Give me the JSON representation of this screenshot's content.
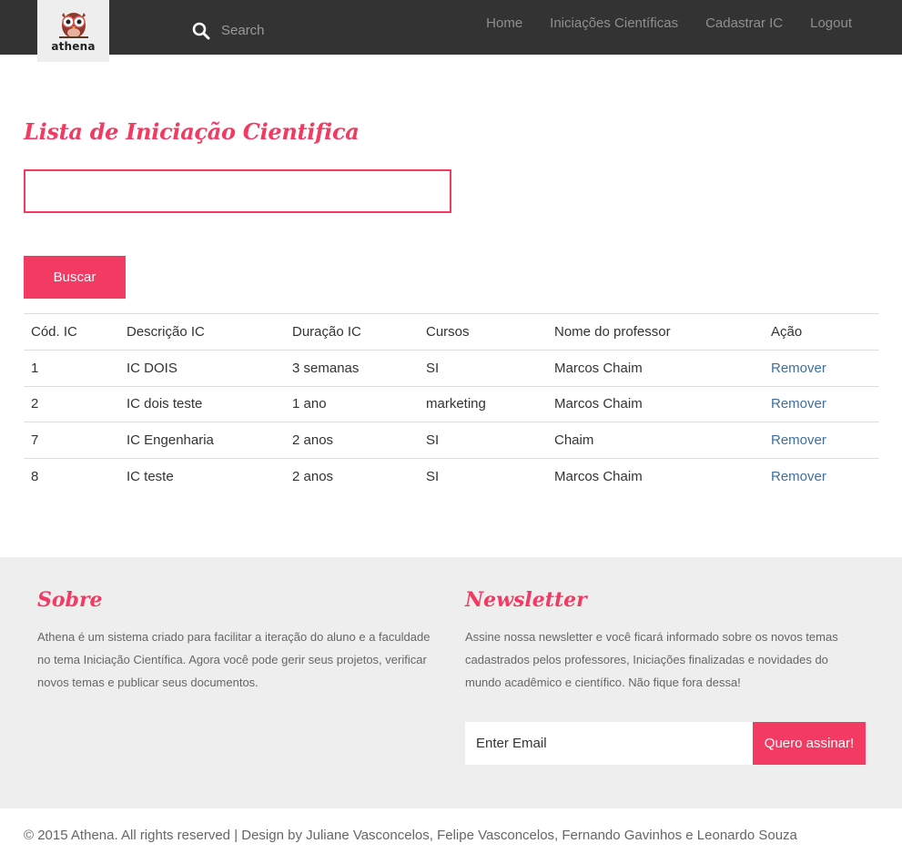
{
  "header": {
    "logo_text": "athena",
    "search_placeholder": "Search",
    "nav": [
      "Home",
      "Iniciações Científicas",
      "Cadastrar IC",
      "Logout"
    ]
  },
  "main": {
    "title": "Lista de Iniciação Cientifica",
    "filter_value": "",
    "search_button": "Buscar",
    "table": {
      "headers": [
        "Cód. IC",
        "Descrição IC",
        "Duração IC",
        "Cursos",
        "Nome do professor",
        "Ação"
      ],
      "rows": [
        {
          "code": "1",
          "description": "IC DOIS",
          "duration": "3 semanas",
          "course": "SI",
          "professor": "Marcos Chaim",
          "action": "Remover"
        },
        {
          "code": "2",
          "description": "IC dois teste",
          "duration": "1 ano",
          "course": "marketing",
          "professor": "Marcos Chaim",
          "action": "Remover"
        },
        {
          "code": "7",
          "description": "IC Engenharia",
          "duration": "2 anos",
          "course": "SI",
          "professor": "Chaim",
          "action": "Remover"
        },
        {
          "code": "8",
          "description": "IC teste",
          "duration": "2 anos",
          "course": "SI",
          "professor": "Marcos Chaim",
          "action": "Remover"
        }
      ]
    }
  },
  "footer": {
    "about_title": "Sobre",
    "about_lines": [
      "Athena é um sistema criado para facilitar a iteração do aluno e a faculdade",
      "no tema Iniciação Científica. Agora você pode gerir seus projetos, verificar",
      "novos temas e publicar seus documentos."
    ],
    "newsletter_title": "Newsletter",
    "newsletter_lines": [
      "Assine nossa newsletter e você ficará informado sobre os novos temas",
      "cadastrados pelos professores, Iniciações finalizadas e novidades do",
      "mundo acadêmico e científico. Não fique fora dessa!"
    ],
    "email_placeholder": "Enter Email",
    "subscribe_button": "Quero assinar!",
    "copyright": "© 2015 Athena. All rights reserved | Design by Juliane Vasconcelos, Felipe Vasconcelos, Fernando Gavinhos e Leonardo Souza"
  },
  "colors": {
    "accent": "#f23a62",
    "header_bg": "#333333",
    "footer_bg": "#eeeeee",
    "link": "#3b6ea5"
  },
  "icons": [
    "owl-logo-icon",
    "search-icon"
  ]
}
